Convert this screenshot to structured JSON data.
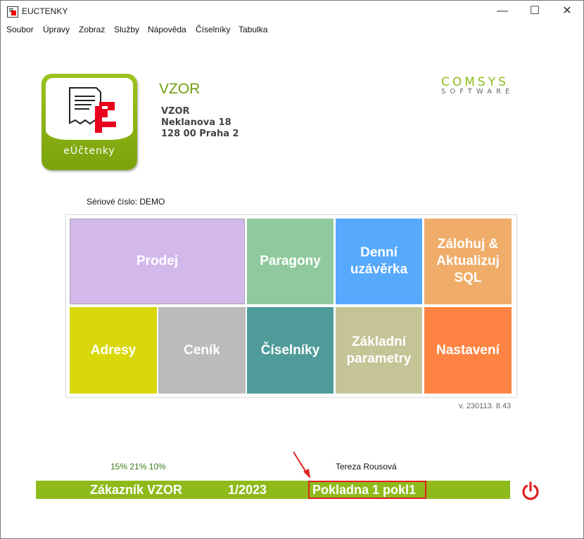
{
  "window": {
    "title": "EUCTENKY"
  },
  "menu": [
    "Soubor",
    "Úpravy",
    "Zobraz",
    "Služby",
    "Nápověda",
    "Číselníky",
    "Tabulka"
  ],
  "logo": {
    "label": "eÚčtenky"
  },
  "company": {
    "name": "VZOR",
    "address": [
      "VZOR",
      "Neklanova 18",
      "128 00 Praha 2"
    ]
  },
  "brand": {
    "top": "COMSYS",
    "bottom": "SOFTWARE"
  },
  "serial": "Sériové číslo: DEMO",
  "tiles": [
    {
      "label": "Prodej",
      "color": "#d3b8ec"
    },
    {
      "label": "Paragony",
      "color": "#8fc99d"
    },
    {
      "label": "Denní uzávěrka",
      "color": "#56a9fd"
    },
    {
      "label": "Zálohuj & Aktualizuj SQL",
      "color": "#f0ad6a"
    },
    {
      "label": "Adresy",
      "color": "#d8d80a"
    },
    {
      "label": "Ceník",
      "color": "#bbbbbb"
    },
    {
      "label": "Číselníky",
      "color": "#4f9b9a"
    },
    {
      "label": "Základní parametry",
      "color": "#c4c497"
    },
    {
      "label": "Nastavení",
      "color": "#ff8443"
    }
  ],
  "version": "v. 230113. 8.43",
  "vat_rates": "15% 21% 10%",
  "user": "Tereza Rousová",
  "status": {
    "customer": "Zákazník VZOR",
    "period": "1/2023",
    "register": "Pokladna 1 pokl1"
  },
  "colors": {
    "accent": "#8fba1b",
    "highlight": "#e02020",
    "power": "#e02020"
  }
}
